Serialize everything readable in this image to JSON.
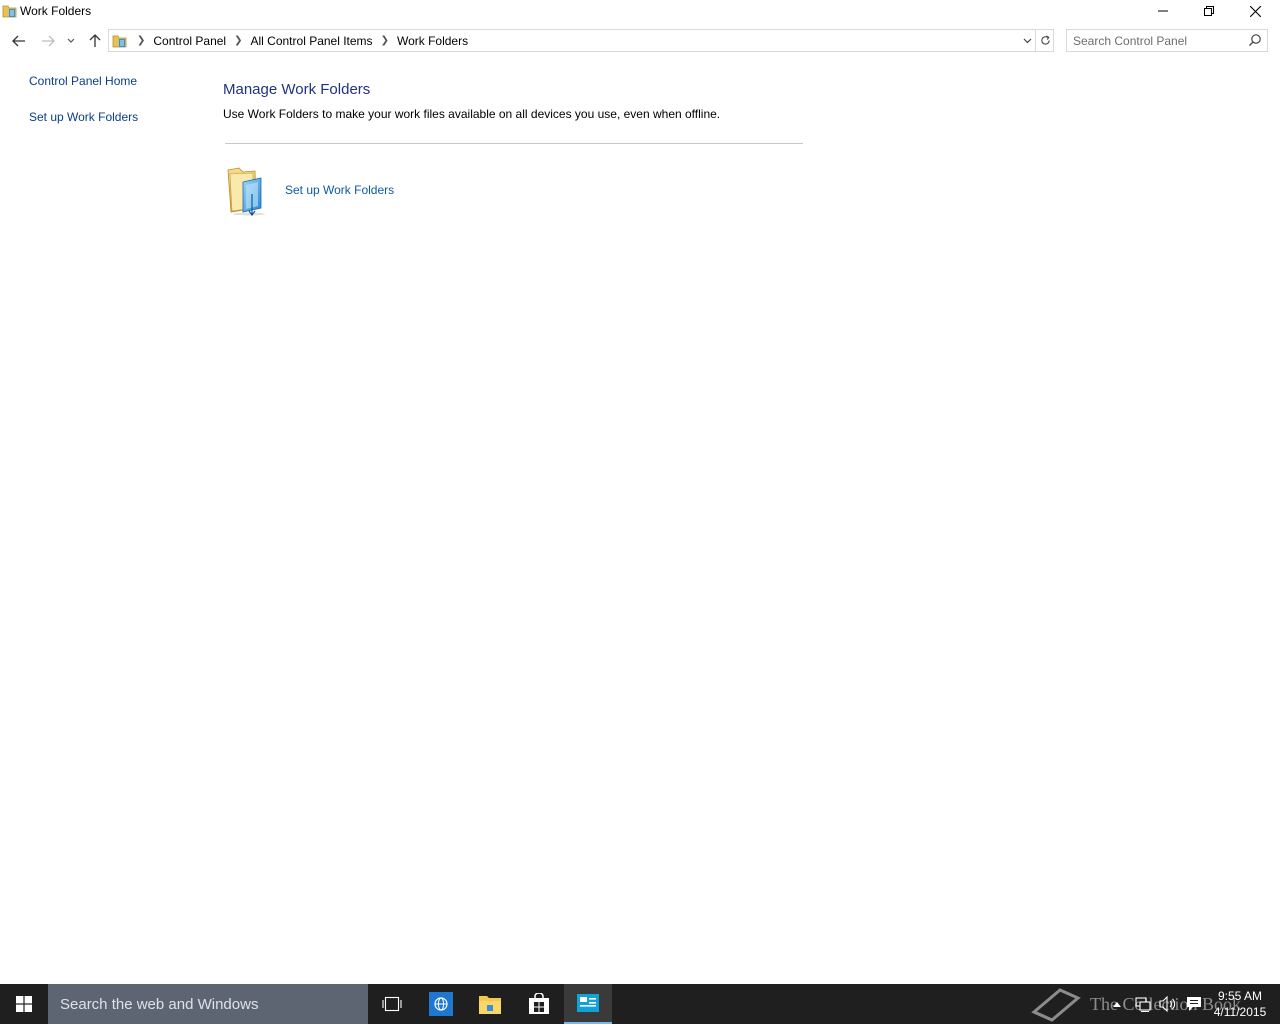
{
  "window": {
    "title": "Work Folders",
    "controls": {
      "minimize": "minimize",
      "maximize": "restore",
      "close": "close"
    }
  },
  "address_bar": {
    "breadcrumbs": [
      "Control Panel",
      "All Control Panel Items",
      "Work Folders"
    ]
  },
  "search": {
    "placeholder": "Search Control Panel"
  },
  "left_pane": {
    "links": [
      "Control Panel Home",
      "Set up Work Folders"
    ]
  },
  "main": {
    "title": "Manage Work Folders",
    "description": "Use Work Folders to make your work files available on all devices you use, even when offline.",
    "task_link": "Set up Work Folders"
  },
  "taskbar": {
    "search_placeholder": "Search the web and Windows",
    "clock_time": "9:55 AM",
    "clock_date": "4/11/2015",
    "watermark": "The Collection Book",
    "pinned": [
      "task-view-icon",
      "internet-explorer-icon",
      "file-explorer-icon",
      "store-icon",
      "control-panel-icon"
    ],
    "accent_color": "#76b9ed",
    "background_color": "#1f1f1f"
  },
  "colors": {
    "link": "#0c3c8c",
    "heading": "#1e3287",
    "task_link": "#0c5aa6"
  }
}
